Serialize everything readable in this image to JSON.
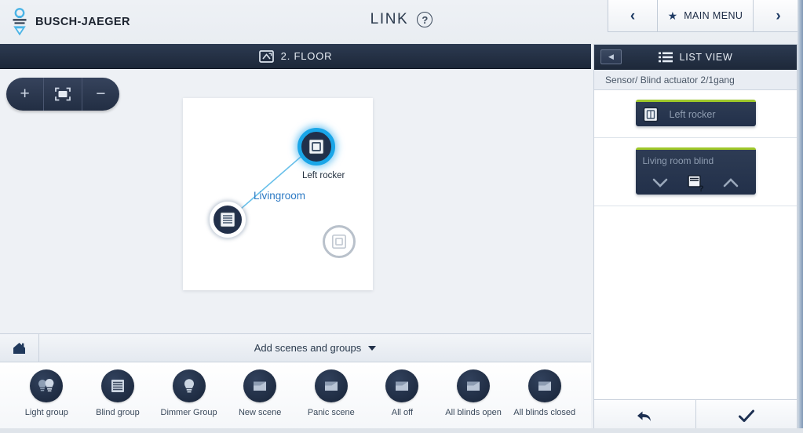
{
  "brand": {
    "name": "BUSCH-JAEGER",
    "logo_icon": "busch-jaeger-logo-icon",
    "accent": "#4bb4e6"
  },
  "header": {
    "title": "LINK",
    "help_icon": "help-circle-icon",
    "help_label": "?",
    "nav": {
      "prev_icon": "chevron-left-icon",
      "prev_label": "‹",
      "star_icon": "star-icon",
      "star_glyph": "★",
      "main_menu_label": "MAIN MENU",
      "next_icon": "chevron-right-icon",
      "next_label": "›"
    }
  },
  "floorbar": {
    "icon": "floorplan-icon",
    "label": "2. FLOOR"
  },
  "plan": {
    "zoom_controls": [
      {
        "name": "zoom-in-button",
        "icon": "plus-icon",
        "glyph": "+"
      },
      {
        "name": "fit-to-screen-button",
        "icon": "fit-screen-icon",
        "glyph": ""
      },
      {
        "name": "zoom-out-button",
        "icon": "minus-icon",
        "glyph": "−"
      }
    ],
    "room_label": "Livingroom",
    "nodes": [
      {
        "name": "node-left-rocker",
        "icon": "rocker-switch-icon",
        "label": "Left rocker",
        "state": "selected",
        "highlight_color": "#19a6e8"
      },
      {
        "name": "node-blind-actuator",
        "icon": "blind-actuator-icon",
        "label": "",
        "state": "linked"
      },
      {
        "name": "node-unassigned-rocker",
        "icon": "rocker-switch-icon",
        "label": "",
        "state": "inactive"
      }
    ],
    "link_color": "#69c0ea"
  },
  "scenes_bar": {
    "home_icon": "home-icon",
    "label": "Add scenes and groups",
    "caret_icon": "chevron-down-icon"
  },
  "palette": [
    {
      "label": "Light group",
      "icon": "light-group-icon"
    },
    {
      "label": "Blind group",
      "icon": "blind-group-icon"
    },
    {
      "label": "Dimmer Group",
      "icon": "dimmer-group-icon"
    },
    {
      "label": "New scene",
      "icon": "scene-icon"
    },
    {
      "label": "Panic scene",
      "icon": "scene-icon"
    },
    {
      "label": "All off",
      "icon": "scene-icon"
    },
    {
      "label": "All blinds open",
      "icon": "scene-icon"
    },
    {
      "label": "All blinds closed",
      "icon": "scene-icon"
    }
  ],
  "right_panel": {
    "collapse_icon": "collapse-panel-icon",
    "collapse_glyph": "◀",
    "list_icon": "list-view-icon",
    "list_view_label": "LIST VIEW",
    "device_name": "Sensor/ Blind actuator 2/1gang",
    "rocker_widget": {
      "icon": "rocker-switch-icon",
      "label": "Left rocker",
      "highlight_color": "#9fc82a"
    },
    "blind_widget": {
      "label": "Living room blind",
      "down_icon": "chevron-down-icon",
      "down_glyph": "⌄",
      "status_icon": "blind-unknown-icon",
      "status_glyph": "?",
      "up_icon": "chevron-up-icon",
      "up_glyph": "⌃",
      "highlight_color": "#9fc82a"
    },
    "footer": [
      {
        "name": "undo-button",
        "icon": "undo-arrow-icon"
      },
      {
        "name": "confirm-button",
        "icon": "checkmark-icon"
      }
    ]
  }
}
